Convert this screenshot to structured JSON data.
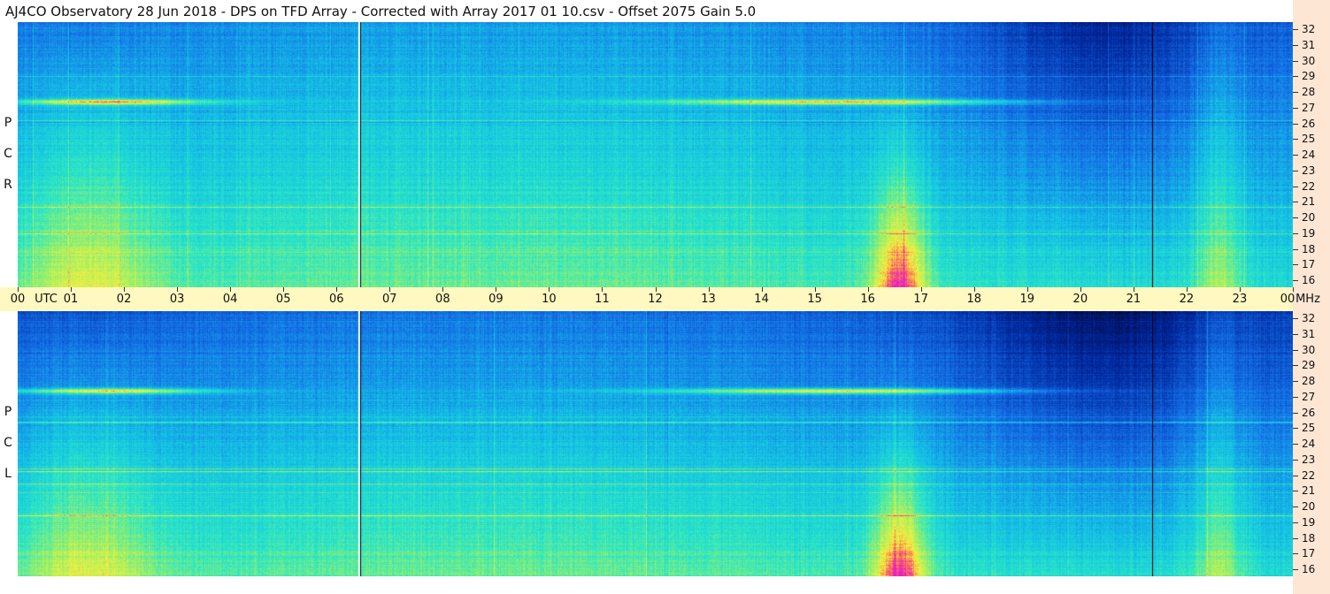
{
  "header": {
    "title": "AJ4CO Observatory  28 Jun 2018  -  DPS on TFD Array  -  Corrected with Array 2017 01 10.csv  -  Offset 2075  Gain 5.0"
  },
  "panels": [
    {
      "id": "rcp",
      "label_letters": [
        "P",
        "C",
        "R"
      ]
    },
    {
      "id": "lcp",
      "label_letters": [
        "P",
        "C",
        "L"
      ]
    }
  ],
  "time_axis": {
    "hours": [
      "00",
      "01",
      "02",
      "03",
      "04",
      "05",
      "06",
      "07",
      "08",
      "09",
      "10",
      "11",
      "12",
      "13",
      "14",
      "15",
      "16",
      "17",
      "18",
      "19",
      "20",
      "21",
      "22",
      "23",
      "00"
    ],
    "utc_label": "UTC",
    "freq_unit_label": "MHz"
  },
  "freq_axis": {
    "labels": [
      "32",
      "31",
      "30",
      "29",
      "28",
      "27",
      "26",
      "25",
      "24",
      "23",
      "22",
      "21",
      "20",
      "19",
      "18",
      "17",
      "16"
    ]
  },
  "colors": {
    "background": "#ffffff",
    "axis_band": "#fff8c0",
    "right_strip": "#fde6d4",
    "data_gap_line": "#ffffff"
  },
  "data_gaps_utc_hours": [
    6.42,
    21.35
  ]
}
